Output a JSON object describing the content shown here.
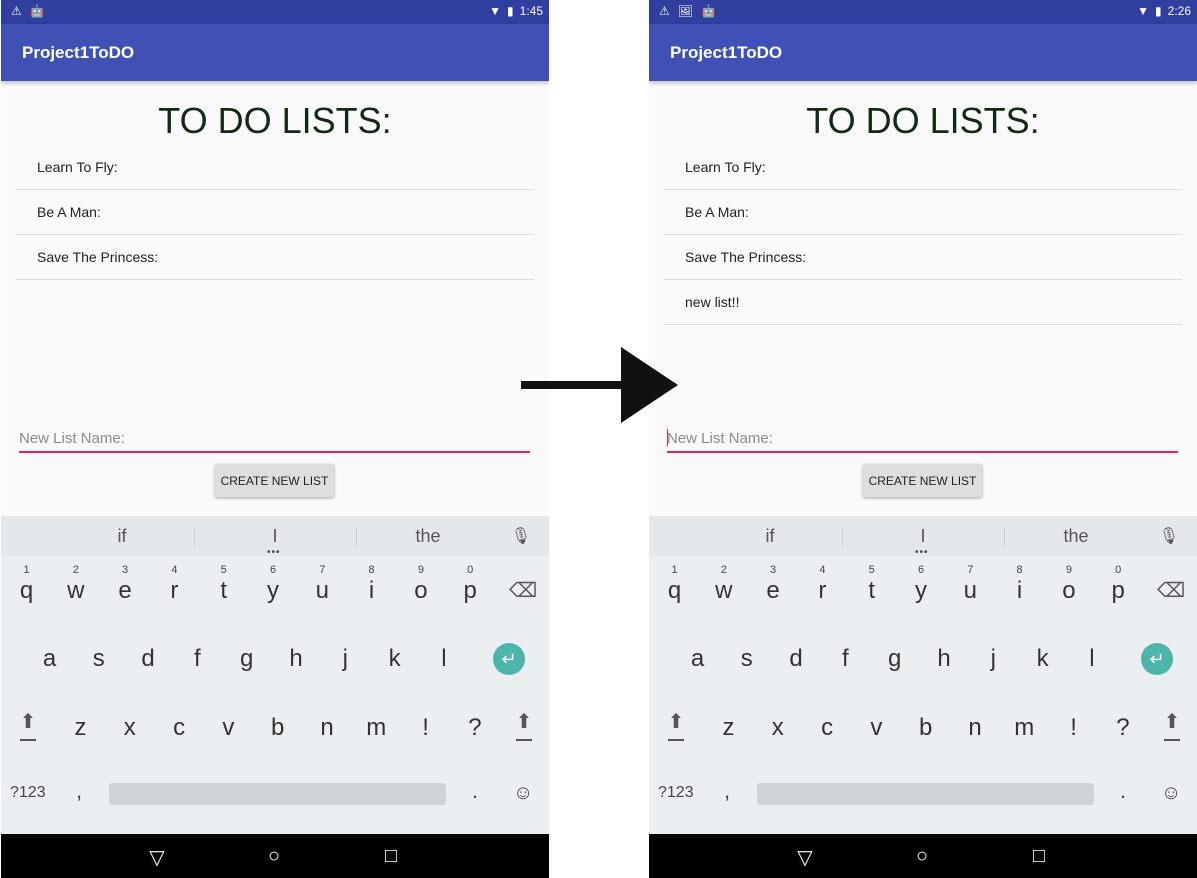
{
  "screens": [
    {
      "status": {
        "left_icons": [
          "⚠",
          "🤖"
        ],
        "time": "1:45"
      },
      "app_title": "Project1ToDO",
      "heading": "TO DO LISTS:",
      "lists": [
        "Learn To Fly:",
        "Be A Man:",
        "Save The Princess:"
      ],
      "input": {
        "placeholder": "New List Name:",
        "value": ""
      },
      "button_label": "CREATE NEW LIST"
    },
    {
      "status": {
        "left_icons": [
          "⚠",
          "🖼",
          "🤖"
        ],
        "time": "2:26"
      },
      "app_title": "Project1ToDO",
      "heading": "TO DO LISTS:",
      "lists": [
        "Learn To Fly:",
        "Be A Man:",
        "Save The Princess:",
        "new list!!"
      ],
      "input": {
        "placeholder": "New List Name:",
        "value": ""
      },
      "button_label": "CREATE NEW LIST"
    }
  ],
  "keyboard": {
    "suggestions": [
      "if",
      "I",
      "the"
    ],
    "row1": [
      "q",
      "w",
      "e",
      "r",
      "t",
      "y",
      "u",
      "i",
      "o",
      "p"
    ],
    "row1_hints": [
      "1",
      "2",
      "3",
      "4",
      "5",
      "6",
      "7",
      "8",
      "9",
      "0"
    ],
    "row2": [
      "a",
      "s",
      "d",
      "f",
      "g",
      "h",
      "j",
      "k",
      "l"
    ],
    "row3": [
      "z",
      "x",
      "c",
      "v",
      "b",
      "n",
      "m",
      "!",
      "?"
    ],
    "symbols_label": "?123",
    "comma": ",",
    "period": "."
  },
  "colors": {
    "appbar": "#3f51b5",
    "statusbar": "#303f9f",
    "accent": "#e91e63",
    "enter_key": "#4db6ac"
  },
  "icons": {
    "wifi": "wifi-icon",
    "battery": "battery-icon",
    "mic": "mic-icon",
    "backspace": "backspace-icon",
    "enter": "enter-icon",
    "shift": "shift-icon",
    "emoji": "emoji-icon",
    "back": "back-icon",
    "home": "home-icon",
    "recents": "recents-icon",
    "transition_arrow": "arrow-right-icon"
  }
}
